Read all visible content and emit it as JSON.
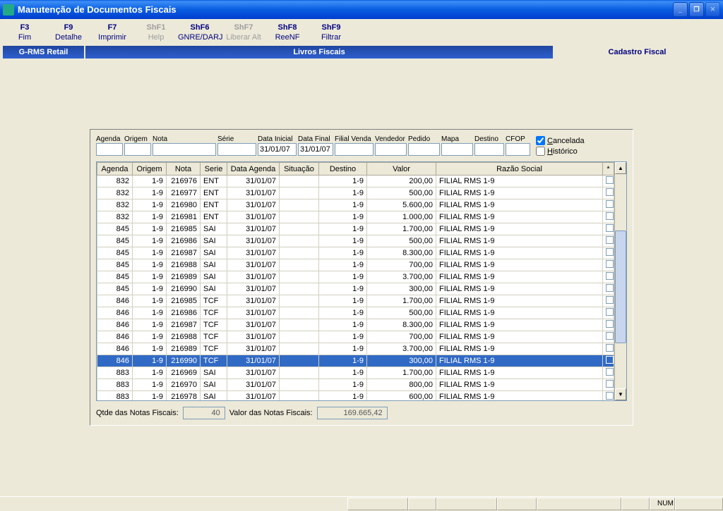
{
  "window": {
    "title": "Manutenção de Documentos Fiscais"
  },
  "toolbar": [
    {
      "key": "F3",
      "label": "Fim",
      "disabled": false
    },
    {
      "key": "F9",
      "label": "Detalhe",
      "disabled": false
    },
    {
      "key": "F7",
      "label": "Imprimir",
      "disabled": false
    },
    {
      "key": "ShF1",
      "label": "Help",
      "disabled": true
    },
    {
      "key": "ShF6",
      "label": "GNRE/DARJ",
      "disabled": false
    },
    {
      "key": "ShF7",
      "label": "Liberar Alt",
      "disabled": true
    },
    {
      "key": "ShF8",
      "label": "ReeNF",
      "disabled": false
    },
    {
      "key": "ShF9",
      "label": "Filtrar",
      "disabled": false
    }
  ],
  "nav": {
    "left": "G-RMS Retail",
    "center": "Livros Fiscais",
    "right": "Cadastro Fiscal"
  },
  "filters": {
    "labels": {
      "agenda": "Agenda",
      "origem": "Origem",
      "nota": "Nota",
      "serie": "Série",
      "data_inicial": "Data Inicial",
      "data_final": "Data Final",
      "filial_venda": "Filial Venda",
      "vendedor": "Vendedor",
      "pedido": "Pedido",
      "mapa": "Mapa",
      "destino": "Destino",
      "cfop": "CFOP"
    },
    "values": {
      "agenda": "",
      "origem": "",
      "nota": "",
      "serie": "",
      "data_inicial": "31/01/07",
      "data_final": "31/01/07",
      "filial_venda": "",
      "vendedor": "",
      "pedido": "",
      "mapa": "",
      "destino": "",
      "cfop": ""
    },
    "checkboxes": {
      "cancelada_label": "Cancelada",
      "cancelada": true,
      "historico_label": "Histórico",
      "historico": false
    }
  },
  "grid": {
    "headers": [
      "Agenda",
      "Origem",
      "Nota",
      "Serie",
      "Data Agenda",
      "Situação",
      "Destino",
      "Valor",
      "Razão Social",
      "*"
    ],
    "rows": [
      {
        "agenda": "832",
        "origem": "1-9",
        "nota": "216976",
        "serie": "ENT",
        "data": "31/01/07",
        "sit": "",
        "dest": "1-9",
        "valor": "200,00",
        "razao": "FILIAL RMS 1-9",
        "sel": false
      },
      {
        "agenda": "832",
        "origem": "1-9",
        "nota": "216977",
        "serie": "ENT",
        "data": "31/01/07",
        "sit": "",
        "dest": "1-9",
        "valor": "500,00",
        "razao": "FILIAL RMS 1-9",
        "sel": false
      },
      {
        "agenda": "832",
        "origem": "1-9",
        "nota": "216980",
        "serie": "ENT",
        "data": "31/01/07",
        "sit": "",
        "dest": "1-9",
        "valor": "5.600,00",
        "razao": "FILIAL RMS 1-9",
        "sel": false
      },
      {
        "agenda": "832",
        "origem": "1-9",
        "nota": "216981",
        "serie": "ENT",
        "data": "31/01/07",
        "sit": "",
        "dest": "1-9",
        "valor": "1.000,00",
        "razao": "FILIAL RMS 1-9",
        "sel": false
      },
      {
        "agenda": "845",
        "origem": "1-9",
        "nota": "216985",
        "serie": "SAI",
        "data": "31/01/07",
        "sit": "",
        "dest": "1-9",
        "valor": "1.700,00",
        "razao": "FILIAL RMS 1-9",
        "sel": false
      },
      {
        "agenda": "845",
        "origem": "1-9",
        "nota": "216986",
        "serie": "SAI",
        "data": "31/01/07",
        "sit": "",
        "dest": "1-9",
        "valor": "500,00",
        "razao": "FILIAL RMS 1-9",
        "sel": false
      },
      {
        "agenda": "845",
        "origem": "1-9",
        "nota": "216987",
        "serie": "SAI",
        "data": "31/01/07",
        "sit": "",
        "dest": "1-9",
        "valor": "8.300,00",
        "razao": "FILIAL RMS 1-9",
        "sel": false
      },
      {
        "agenda": "845",
        "origem": "1-9",
        "nota": "216988",
        "serie": "SAI",
        "data": "31/01/07",
        "sit": "",
        "dest": "1-9",
        "valor": "700,00",
        "razao": "FILIAL RMS 1-9",
        "sel": false
      },
      {
        "agenda": "845",
        "origem": "1-9",
        "nota": "216989",
        "serie": "SAI",
        "data": "31/01/07",
        "sit": "",
        "dest": "1-9",
        "valor": "3.700,00",
        "razao": "FILIAL RMS 1-9",
        "sel": false
      },
      {
        "agenda": "845",
        "origem": "1-9",
        "nota": "216990",
        "serie": "SAI",
        "data": "31/01/07",
        "sit": "",
        "dest": "1-9",
        "valor": "300,00",
        "razao": "FILIAL RMS 1-9",
        "sel": false
      },
      {
        "agenda": "846",
        "origem": "1-9",
        "nota": "216985",
        "serie": "TCF",
        "data": "31/01/07",
        "sit": "",
        "dest": "1-9",
        "valor": "1.700,00",
        "razao": "FILIAL RMS 1-9",
        "sel": false
      },
      {
        "agenda": "846",
        "origem": "1-9",
        "nota": "216986",
        "serie": "TCF",
        "data": "31/01/07",
        "sit": "",
        "dest": "1-9",
        "valor": "500,00",
        "razao": "FILIAL RMS 1-9",
        "sel": false
      },
      {
        "agenda": "846",
        "origem": "1-9",
        "nota": "216987",
        "serie": "TCF",
        "data": "31/01/07",
        "sit": "",
        "dest": "1-9",
        "valor": "8.300,00",
        "razao": "FILIAL RMS 1-9",
        "sel": false
      },
      {
        "agenda": "846",
        "origem": "1-9",
        "nota": "216988",
        "serie": "TCF",
        "data": "31/01/07",
        "sit": "",
        "dest": "1-9",
        "valor": "700,00",
        "razao": "FILIAL RMS 1-9",
        "sel": false
      },
      {
        "agenda": "846",
        "origem": "1-9",
        "nota": "216989",
        "serie": "TCF",
        "data": "31/01/07",
        "sit": "",
        "dest": "1-9",
        "valor": "3.700,00",
        "razao": "FILIAL RMS 1-9",
        "sel": false
      },
      {
        "agenda": "846",
        "origem": "1-9",
        "nota": "216990",
        "serie": "TCF",
        "data": "31/01/07",
        "sit": "",
        "dest": "1-9",
        "valor": "300,00",
        "razao": "FILIAL RMS 1-9",
        "sel": true
      },
      {
        "agenda": "883",
        "origem": "1-9",
        "nota": "216969",
        "serie": "SAI",
        "data": "31/01/07",
        "sit": "",
        "dest": "1-9",
        "valor": "1.700,00",
        "razao": "FILIAL RMS 1-9",
        "sel": false
      },
      {
        "agenda": "883",
        "origem": "1-9",
        "nota": "216970",
        "serie": "SAI",
        "data": "31/01/07",
        "sit": "",
        "dest": "1-9",
        "valor": "800,00",
        "razao": "FILIAL RMS 1-9",
        "sel": false
      },
      {
        "agenda": "883",
        "origem": "1-9",
        "nota": "216978",
        "serie": "SAI",
        "data": "31/01/07",
        "sit": "",
        "dest": "1-9",
        "valor": "600,00",
        "razao": "FILIAL RMS 1-9",
        "sel": false
      }
    ]
  },
  "summary": {
    "qtde_label": "Qtde das Notas Fiscais:",
    "qtde": "40",
    "valor_label": "Valor  das Notas Fiscais:",
    "valor": "169.665,42"
  },
  "statusbar": {
    "num": "NUM"
  }
}
